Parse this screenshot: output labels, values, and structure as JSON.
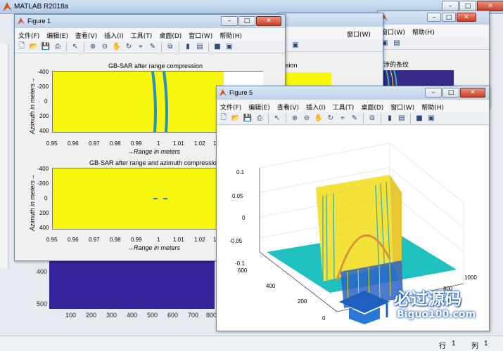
{
  "app": {
    "title": "MATLAB R2018a",
    "status_row_label": "行",
    "status_row_value": "1",
    "status_col_label": "列",
    "status_col_value": "1"
  },
  "menu": [
    "文件(F)",
    "编辑(E)",
    "查看(V)",
    "插入(I)",
    "工具(T)",
    "桌面(D)",
    "窗口(W)",
    "帮助(H)"
  ],
  "figure1": {
    "title": "Figure 1",
    "axes1": {
      "title": "GB-SAR after range compression",
      "xlabel": "→Range in meters",
      "ylabel": "Azimuth in meters→",
      "xticks": [
        "0.95",
        "0.96",
        "0.97",
        "0.98",
        "0.99",
        "1",
        "1.01",
        "1.02",
        "1.0"
      ],
      "yticks": [
        "-400",
        "-200",
        "0",
        "200",
        "400"
      ]
    },
    "axes2": {
      "title": "GB-SAR after range and azimuth compressio",
      "xlabel": "→Range in meters",
      "ylabel": "Azimuth in meters→",
      "xticks": [
        "0.95",
        "0.96",
        "0.97",
        "0.98",
        "0.99",
        "1",
        "1.01",
        "1.02",
        "1.0"
      ],
      "yticks": [
        "-400",
        "-200",
        "0",
        "200",
        "400"
      ]
    }
  },
  "figure_mid": {
    "title_fragment": "sion",
    "menu_fragment": "窗口(W)",
    "menu_fragment2": "帮助(H)"
  },
  "figure_right": {
    "menu_fragment": "窗口(W)",
    "menu_fragment2": "帮助(H)",
    "title_fragment": "涉的条纹"
  },
  "figure5": {
    "title": "Figure 5",
    "zticks": [
      "0.1",
      "0.05",
      "0",
      "-0.05",
      "-0.1"
    ],
    "yticks": [
      "600",
      "400",
      "200",
      "0"
    ],
    "xticks": [
      "1000",
      "800"
    ]
  },
  "background_axes": {
    "yticks": [
      "400",
      "500"
    ],
    "xticks": [
      "100",
      "200",
      "300",
      "400",
      "500",
      "600",
      "700",
      "800"
    ]
  },
  "watermark": {
    "cn": "必过源码",
    "en": "Biguo100.com"
  },
  "colors": {
    "parula_yellow": "#f9f70e",
    "parula_blue": "#352a87",
    "parula_teal": "#14bdbd"
  }
}
